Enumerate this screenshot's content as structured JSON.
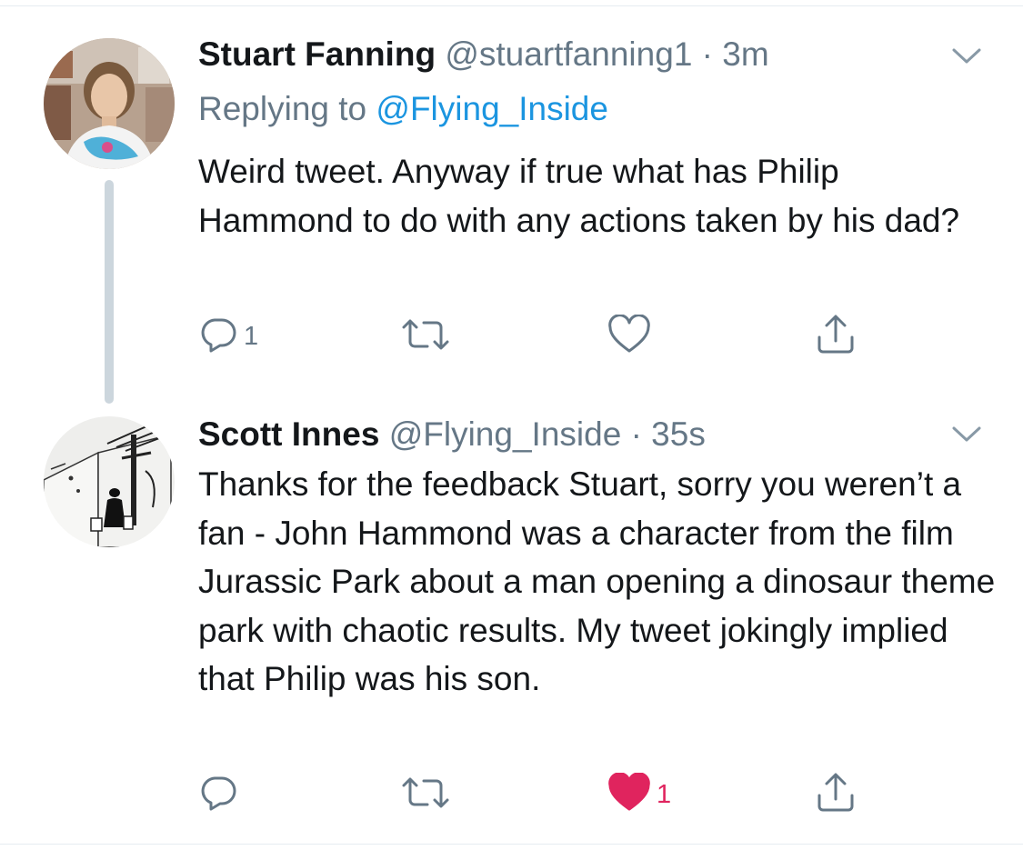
{
  "tweets": [
    {
      "author_name": "Stuart Fanning",
      "handle": "@stuartfanning1",
      "separator": "·",
      "time": "3m",
      "replying_prefix": "Replying to",
      "replying_to": "@Flying_Inside",
      "text": "Weird tweet. Anyway if true what has Philip Hammond to do with any actions taken by his dad?",
      "actions": {
        "reply_count": "1",
        "retweet_count": "",
        "like_count": "",
        "liked": false
      }
    },
    {
      "author_name": "Scott Innes",
      "handle": "@Flying_Inside",
      "separator": "·",
      "time": "35s",
      "text": "Thanks for the feedback Stuart, sorry you weren’t a fan - John Hammond was a character from the film Jurassic Park about a man opening a dinosaur theme park with chaotic results. My tweet jokingly implied that Philip was his son.",
      "actions": {
        "reply_count": "",
        "retweet_count": "",
        "like_count": "1",
        "liked": true
      }
    }
  ],
  "icons": {
    "reply": "reply-icon",
    "retweet": "retweet-icon",
    "like": "heart-icon",
    "share": "share-icon",
    "more": "chevron-down-icon"
  },
  "colors": {
    "text": "#14171a",
    "secondary": "#657786",
    "link": "#1b95e0",
    "like": "#e0245e",
    "thread_line": "#ccd6dd"
  }
}
